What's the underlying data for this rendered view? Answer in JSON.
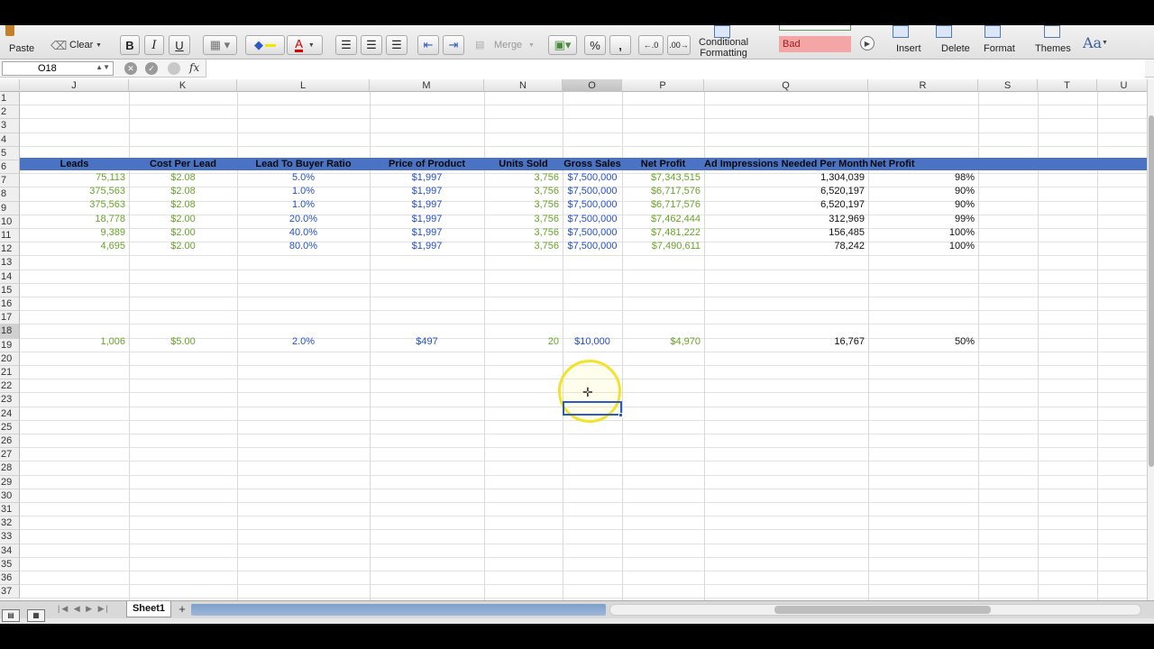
{
  "ribbon": {
    "paste": "Paste",
    "clear": "Clear",
    "bold": "B",
    "italic": "I",
    "underline": "U",
    "font_color": "A",
    "merge": "Merge",
    "percent": "%",
    "comma": ",",
    "cond_format_line1": "Conditional",
    "cond_format_line2": "Formatting",
    "style_bad": "Bad",
    "insert": "Insert",
    "delete": "Delete",
    "format": "Format",
    "themes": "Themes",
    "theme_fonts": "Aa"
  },
  "formula_bar": {
    "name_box": "O18",
    "fx": "fx",
    "value": ""
  },
  "columns": [
    "J",
    "K",
    "L",
    "M",
    "N",
    "O",
    "P",
    "Q",
    "R",
    "S",
    "T",
    "U"
  ],
  "selected_column": "O",
  "rows": [
    "1",
    "2",
    "3",
    "4",
    "5",
    "6",
    "7",
    "8",
    "9",
    "10",
    "11",
    "12",
    "13",
    "14",
    "15",
    "16",
    "17",
    "18",
    "19",
    "20",
    "21",
    "22",
    "23",
    "24",
    "25",
    "26",
    "27",
    "28",
    "29",
    "30",
    "31",
    "32",
    "33",
    "34",
    "35",
    "36",
    "37"
  ],
  "selected_row": "18",
  "table_headers": {
    "leads": "Leads",
    "cost_per_lead": "Cost Per Lead",
    "ratio": "Lead To Buyer Ratio",
    "price": "Price of Product",
    "units": "Units Sold",
    "gross": "Gross Sales",
    "net": "Net Profit",
    "impressions": "Ad Impressions Needed Per Month",
    "net_profit_pct": "Net Profit"
  },
  "data_rows": [
    {
      "leads": "75,113",
      "cpl": "$2.08",
      "ratio": "5.0%",
      "price": "$1,997",
      "units": "3,756",
      "gross": "$7,500,000",
      "net": "$7,343,515",
      "impr": "1,304,039",
      "pct": "98%"
    },
    {
      "leads": "375,563",
      "cpl": "$2.08",
      "ratio": "1.0%",
      "price": "$1,997",
      "units": "3,756",
      "gross": "$7,500,000",
      "net": "$6,717,576",
      "impr": "6,520,197",
      "pct": "90%"
    },
    {
      "leads": "375,563",
      "cpl": "$2.08",
      "ratio": "1.0%",
      "price": "$1,997",
      "units": "3,756",
      "gross": "$7,500,000",
      "net": "$6,717,576",
      "impr": "6,520,197",
      "pct": "90%"
    },
    {
      "leads": "18,778",
      "cpl": "$2.00",
      "ratio": "20.0%",
      "price": "$1,997",
      "units": "3,756",
      "gross": "$7,500,000",
      "net": "$7,462,444",
      "impr": "312,969",
      "pct": "99%"
    },
    {
      "leads": "9,389",
      "cpl": "$2.00",
      "ratio": "40.0%",
      "price": "$1,997",
      "units": "3,756",
      "gross": "$7,500,000",
      "net": "$7,481,222",
      "impr": "156,485",
      "pct": "100%"
    },
    {
      "leads": "4,695",
      "cpl": "$2.00",
      "ratio": "80.0%",
      "price": "$1,997",
      "units": "3,756",
      "gross": "$7,500,000",
      "net": "$7,490,611",
      "impr": "78,242",
      "pct": "100%"
    }
  ],
  "row17": {
    "leads": "1,006",
    "cpl": "$5.00",
    "ratio": "2.0%",
    "price": "$497",
    "units": "20",
    "gross": "$10,000",
    "net": "$4,970",
    "impr": "16,767",
    "pct": "50%"
  },
  "sheet_tabs": [
    "Sheet1"
  ],
  "add_sheet": "+",
  "colors": {
    "header_band": "#4a73c3",
    "green_text": "#6aa329",
    "blue_text": "#2550c8",
    "selection": "#2a5bc4",
    "cursor_highlight": "#f1e32a"
  }
}
